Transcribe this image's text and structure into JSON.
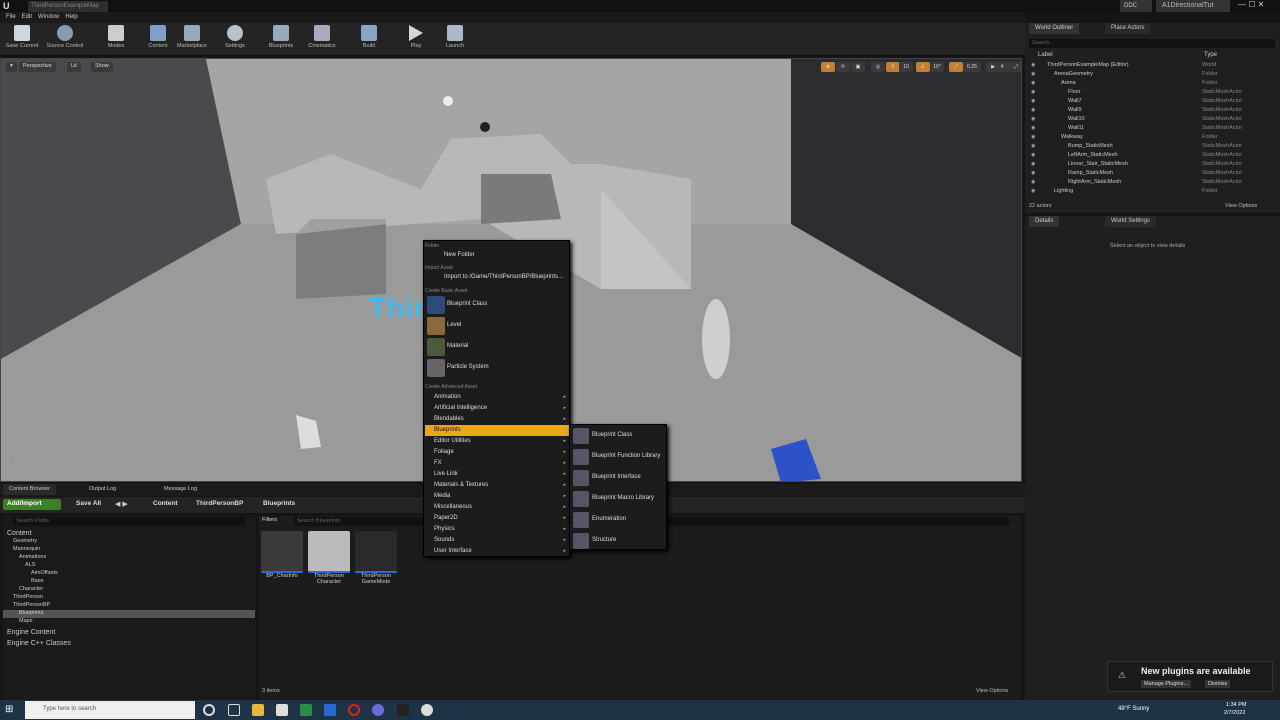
{
  "window": {
    "logo": "U",
    "doc_tab": "ThirdPersonExampleMap",
    "ddc": "DDC",
    "right_title": "A1DirectionalTut",
    "controls": "—  ☐  ✕"
  },
  "menubar": [
    "File",
    "Edit",
    "Window",
    "Help"
  ],
  "toolbar": [
    "Save Current",
    "Source Control",
    "Modes",
    "Content",
    "Marketplace",
    "Settings",
    "Blueprints",
    "Cinematics",
    "Build",
    "Play",
    "Launch"
  ],
  "viewport": {
    "perspective": "Perspective",
    "lit": "Lit",
    "show": "Show",
    "grid": "10",
    "angle": "10°",
    "scale": "0.25",
    "cam": "4",
    "floor_text": "Third    rson"
  },
  "context_menu": {
    "sections": {
      "folder": "Folder",
      "import": "Import Asset",
      "basic": "Create Basic Asset",
      "advanced": "Create Advanced Asset"
    },
    "new_folder": "New Folder",
    "import_to": "Import to /Game/ThirdPersonBP/Blueprints...",
    "basic_items": [
      "Blueprint Class",
      "Level",
      "Material",
      "Particle System"
    ],
    "advanced_items": [
      "Animation",
      "Artificial Intelligence",
      "Blendables",
      "Blueprints",
      "Editor Utilities",
      "Foliage",
      "FX",
      "Live Link",
      "Materials & Textures",
      "Media",
      "Miscellaneous",
      "Paper2D",
      "Physics",
      "Sounds",
      "User Interface"
    ],
    "highlighted": "Blueprints"
  },
  "submenu": [
    "Blueprint Class",
    "Blueprint Function Library",
    "Blueprint Interface",
    "Blueprint Macro Library",
    "Enumeration",
    "Structure"
  ],
  "outliner": {
    "tabs": [
      "World Outliner",
      "Place Actors"
    ],
    "search_placeholder": "Search...",
    "col_label": "Label",
    "col_type": "Type",
    "rows": [
      {
        "name": "ThirdPersonExampleMap (Editor)",
        "type": "World",
        "indent": 0
      },
      {
        "name": "ArenaGeometry",
        "type": "Folder",
        "indent": 1
      },
      {
        "name": "Arena",
        "type": "Folder",
        "indent": 2
      },
      {
        "name": "Floor",
        "type": "StaticMeshActor",
        "indent": 3
      },
      {
        "name": "Wall7",
        "type": "StaticMeshActor",
        "indent": 3
      },
      {
        "name": "Wall9",
        "type": "StaticMeshActor",
        "indent": 3
      },
      {
        "name": "Wall10",
        "type": "StaticMeshActor",
        "indent": 3
      },
      {
        "name": "Wall11",
        "type": "StaticMeshActor",
        "indent": 3
      },
      {
        "name": "Walkway",
        "type": "Folder",
        "indent": 2
      },
      {
        "name": "Bump_StaticMesh",
        "type": "StaticMeshActor",
        "indent": 3
      },
      {
        "name": "LeftArm_StaticMesh",
        "type": "StaticMeshActor",
        "indent": 3
      },
      {
        "name": "Linear_Stair_StaticMesh",
        "type": "StaticMeshActor",
        "indent": 3
      },
      {
        "name": "Ramp_StaticMesh",
        "type": "StaticMeshActor",
        "indent": 3
      },
      {
        "name": "RightArm_StaticMesh",
        "type": "StaticMeshActor",
        "indent": 3
      },
      {
        "name": "Lighting",
        "type": "Folder",
        "indent": 1
      }
    ],
    "actor_count": "22 actors",
    "view_options": "View Options"
  },
  "details": {
    "tabs": [
      "Details",
      "World Settings"
    ],
    "empty": "Select an object to view details"
  },
  "content_browser": {
    "tabs": [
      "Content Browser",
      "Output Log",
      "Message Log"
    ],
    "add_import": "Add/Import",
    "save_all": "Save All",
    "breadcrumb": [
      "Content",
      "ThirdPersonBP",
      "Blueprints"
    ],
    "search_paths": "Search Paths",
    "filters": "Filters",
    "search_blueprints": "Search Blueprints",
    "tree": [
      {
        "name": "Content",
        "indent": 0,
        "big": true
      },
      {
        "name": "Geometry",
        "indent": 1
      },
      {
        "name": "Mannequin",
        "indent": 1
      },
      {
        "name": "Animations",
        "indent": 2
      },
      {
        "name": "ALS",
        "indent": 3
      },
      {
        "name": "AimOffsets",
        "indent": 4
      },
      {
        "name": "Base",
        "indent": 4
      },
      {
        "name": "Character",
        "indent": 2
      },
      {
        "name": "ThirdPerson",
        "indent": 1
      },
      {
        "name": "ThirdPersonBP",
        "indent": 1
      },
      {
        "name": "Blueprints",
        "indent": 2,
        "selected": true
      },
      {
        "name": "Maps",
        "indent": 2
      },
      {
        "name": "Engine Content",
        "indent": 0,
        "big": true
      },
      {
        "name": "Engine C++ Classes",
        "indent": 0,
        "big": true
      }
    ],
    "assets": [
      {
        "line1": "BP_CharInfo",
        "line2": ""
      },
      {
        "line1": "ThirdPerson",
        "line2": "Character"
      },
      {
        "line1": "ThirdPerson",
        "line2": "GameMode"
      }
    ],
    "item_count": "3 items",
    "view_options": "View Options"
  },
  "notification": {
    "title": "New plugins are available",
    "manage": "Manage Plugins...",
    "dismiss": "Dismiss"
  },
  "taskbar": {
    "search": "Type here to search",
    "weather": "48°F  Sunny",
    "time": "1:34 PM",
    "date": "2/7/2022"
  }
}
